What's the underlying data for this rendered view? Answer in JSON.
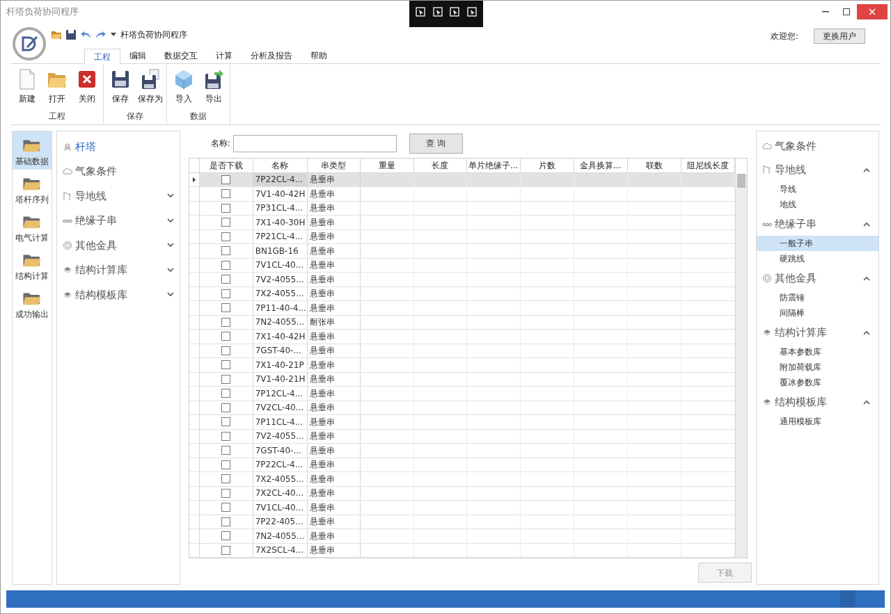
{
  "window": {
    "title": "杆塔负荷协同程序"
  },
  "quick_access": {
    "title": "杆塔负荷协同程序"
  },
  "ribbon_tabs": [
    {
      "label": "工程",
      "selected": true
    },
    {
      "label": "编辑",
      "selected": false
    },
    {
      "label": "数据交互",
      "selected": false
    },
    {
      "label": "计算",
      "selected": false
    },
    {
      "label": "分析及报告",
      "selected": false
    },
    {
      "label": "帮助",
      "selected": false
    }
  ],
  "user": {
    "welcome": "欢迎您:",
    "switch_button": "更换用户"
  },
  "ribbon_groups": [
    {
      "label": "工程",
      "buttons": [
        {
          "label": "新建",
          "kind": "new"
        },
        {
          "label": "打开",
          "kind": "open"
        },
        {
          "label": "关闭",
          "kind": "close"
        }
      ]
    },
    {
      "label": "保存",
      "buttons": [
        {
          "label": "保存",
          "kind": "save"
        },
        {
          "label": "保存为",
          "kind": "saveas"
        }
      ]
    },
    {
      "label": "数据",
      "buttons": [
        {
          "label": "导入",
          "kind": "import"
        },
        {
          "label": "导出",
          "kind": "export"
        }
      ]
    }
  ],
  "nav": [
    {
      "label": "基础数据",
      "selected": true
    },
    {
      "label": "塔杆序列",
      "selected": false
    },
    {
      "label": "电气计算",
      "selected": false
    },
    {
      "label": "结构计算",
      "selected": false
    },
    {
      "label": "成功输出",
      "selected": false
    }
  ],
  "tree": [
    {
      "label": "杆塔",
      "kind": "tower",
      "selected": true
    },
    {
      "label": "气象条件",
      "kind": "cloud",
      "selected": false
    },
    {
      "label": "导地线",
      "kind": "line",
      "selected": false,
      "expanded": false
    },
    {
      "label": "绝缘子串",
      "kind": "dots",
      "selected": false,
      "expanded": false
    },
    {
      "label": "其他金具",
      "kind": "ring",
      "selected": false,
      "expanded": false
    },
    {
      "label": "结构计算库",
      "kind": "layers",
      "selected": false,
      "expanded": false
    },
    {
      "label": "结构模板库",
      "kind": "layers",
      "selected": false,
      "expanded": false
    }
  ],
  "search": {
    "label": "名称:",
    "button": "查 询"
  },
  "table": {
    "columns": [
      "是否下载",
      "名称",
      "串类型",
      "重量",
      "长度",
      "单片绝缘子...",
      "片数",
      "金具换算...",
      "联数",
      "阻尼线长度"
    ],
    "rows": [
      {
        "name": "7P22CL-4...",
        "type": "悬垂串",
        "checked": false,
        "selected": true
      },
      {
        "name": "7V1-40-42H",
        "type": "悬垂串",
        "checked": false,
        "selected": false
      },
      {
        "name": "7P31CL-4...",
        "type": "悬垂串",
        "checked": false,
        "selected": false
      },
      {
        "name": "7X1-40-30H",
        "type": "悬垂串",
        "checked": false,
        "selected": false
      },
      {
        "name": "7P21CL-4...",
        "type": "悬垂串",
        "checked": false,
        "selected": false
      },
      {
        "name": "BN1GB-16",
        "type": "悬垂串",
        "checked": false,
        "selected": false
      },
      {
        "name": "7V1CL-40...",
        "type": "悬垂串",
        "checked": false,
        "selected": false
      },
      {
        "name": "7V2-4055...",
        "type": "悬垂串",
        "checked": false,
        "selected": false
      },
      {
        "name": "7X2-4055...",
        "type": "悬垂串",
        "checked": false,
        "selected": false
      },
      {
        "name": "7P11-40-4...",
        "type": "悬垂串",
        "checked": false,
        "selected": false
      },
      {
        "name": "7N2-4055...",
        "type": "耐张串",
        "checked": false,
        "selected": false
      },
      {
        "name": "7X1-40-42H",
        "type": "悬垂串",
        "checked": false,
        "selected": false
      },
      {
        "name": "7GST-40-...",
        "type": "悬垂串",
        "checked": false,
        "selected": false
      },
      {
        "name": "7X1-40-21P",
        "type": "悬垂串",
        "checked": false,
        "selected": false
      },
      {
        "name": "7V1-40-21H",
        "type": "悬垂串",
        "checked": false,
        "selected": false
      },
      {
        "name": "7P12CL-4...",
        "type": "悬垂串",
        "checked": false,
        "selected": false
      },
      {
        "name": "7V2CL-40...",
        "type": "悬垂串",
        "checked": false,
        "selected": false
      },
      {
        "name": "7P11CL-4...",
        "type": "悬垂串",
        "checked": false,
        "selected": false
      },
      {
        "name": "7V2-4055...",
        "type": "悬垂串",
        "checked": false,
        "selected": false
      },
      {
        "name": "7GST-40-...",
        "type": "悬垂串",
        "checked": false,
        "selected": false
      },
      {
        "name": "7P22CL-4...",
        "type": "悬垂串",
        "checked": false,
        "selected": false
      },
      {
        "name": "7X2-4055...",
        "type": "悬垂串",
        "checked": false,
        "selected": false
      },
      {
        "name": "7X2CL-40...",
        "type": "悬垂串",
        "checked": false,
        "selected": false
      },
      {
        "name": "7V1CL-40...",
        "type": "悬垂串",
        "checked": false,
        "selected": false
      },
      {
        "name": "7P22-405...",
        "type": "悬垂串",
        "checked": false,
        "selected": false
      },
      {
        "name": "7N2-4055...",
        "type": "悬垂串",
        "checked": false,
        "selected": false
      },
      {
        "name": "7X2SCL-4...",
        "type": "悬垂串",
        "checked": false,
        "selected": false
      }
    ]
  },
  "download_button": {
    "label": "下载",
    "disabled": true
  },
  "right_panel": [
    {
      "label": "气象条件",
      "kind": "cloud"
    },
    {
      "label": "导地线",
      "kind": "line",
      "expanded": true,
      "children": [
        {
          "label": "导线",
          "selected": false
        },
        {
          "label": "地线",
          "selected": false
        }
      ]
    },
    {
      "label": "绝缘子串",
      "kind": "dots",
      "expanded": true,
      "children": [
        {
          "label": "一般子串",
          "selected": true
        },
        {
          "label": "硬跳线",
          "selected": false
        }
      ]
    },
    {
      "label": "其他金具",
      "kind": "ring",
      "expanded": true,
      "children": [
        {
          "label": "防震锤",
          "selected": false
        },
        {
          "label": "间隔棒",
          "selected": false
        }
      ]
    },
    {
      "label": "结构计算库",
      "kind": "layers",
      "expanded": true,
      "children": [
        {
          "label": "基本参数库",
          "selected": false
        },
        {
          "label": "附加荷载库",
          "selected": false
        },
        {
          "label": "覆冰参数库",
          "selected": false
        }
      ]
    },
    {
      "label": "结构模板库",
      "kind": "layers",
      "expanded": true,
      "children": [
        {
          "label": "通用模板库",
          "selected": false
        }
      ]
    }
  ]
}
